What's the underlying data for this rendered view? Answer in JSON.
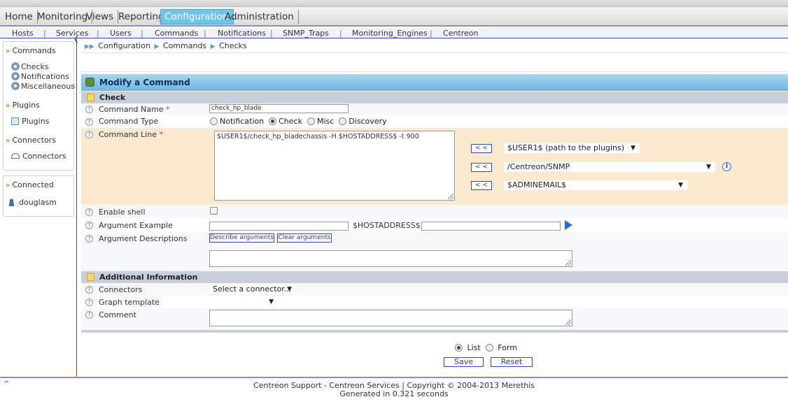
{
  "topmenu": {
    "items": [
      "Home",
      "Monitoring",
      "Views",
      "Reporting",
      "Configuration",
      "Administration"
    ],
    "active": "Configuration"
  },
  "submenu": {
    "items": [
      "Hosts",
      "Services",
      "Users",
      "Commands",
      "Notifications",
      "SNMP_Traps",
      "Monitoring_Engines",
      "Centreon"
    ]
  },
  "sidebar": {
    "commands_header": "Commands",
    "commands_items": [
      "Checks",
      "Notifications",
      "Miscellaneous"
    ],
    "plugins_header": "Plugins",
    "plugins_item": "Plugins",
    "connectors_header": "Connectors",
    "connectors_item": "Connectors",
    "connected_header": "Connected",
    "user": "douglasm"
  },
  "breadcrumb": [
    "Configuration",
    "Commands",
    "Checks"
  ],
  "form": {
    "title": "Modify a Command",
    "section_check": "Check",
    "command_name_label": "Command Name",
    "command_name_value": "check_hp_blade",
    "command_type_label": "Command Type",
    "command_type_options": [
      "Notification",
      "Check",
      "Misc",
      "Discovery"
    ],
    "command_type_selected": "Check",
    "command_line_label": "Command Line",
    "command_line_value": "$USER1$/check_hp_bladechassis -H $HOSTADDRESS$ -t 900",
    "macro_button": "< <",
    "macro_selects": [
      "$USER1$ (path to the plugins)",
      "/Centreon/SNMP",
      "$ADMINEMAIL$"
    ],
    "enable_shell_label": "Enable shell",
    "argument_example_label": "Argument Example",
    "argument_example_macro": "$HOSTADDRESS$",
    "argument_descriptions_label": "Argument Descriptions",
    "describe_arguments_button": "Describe arguments",
    "clear_arguments_button": "Clear arguments",
    "section_additional": "Additional Information",
    "connectors_label": "Connectors",
    "connectors_select": "Select a connector...",
    "graph_template_label": "Graph template",
    "graph_template_select": "",
    "comment_label": "Comment",
    "required_mark": "*",
    "help_mark": "?",
    "info_mark": "i"
  },
  "bottom": {
    "view_options": [
      "List",
      "Form"
    ],
    "view_selected": "List",
    "save_label": "Save",
    "reset_label": "Reset"
  },
  "footer": {
    "line1": "Centreon Support - Centreon Services | Copyright © 2004-2013 Merethis",
    "line2": "Generated in 0.321 seconds"
  },
  "icons": {
    "breadcrumb_start": "double-arrow-icon",
    "breadcrumb_sep": "triangle-right-icon",
    "help": "question-circle-icon",
    "chevron": "double-chevron-icon",
    "scroll_up": "caret-up-icon"
  },
  "colors": {
    "active_tab": "#6ec5ea",
    "panel_header": "#6eb7e2",
    "orange_row": "#fbe9d0",
    "link_blue": "#2a3a94",
    "chevron": "#e07b1a"
  }
}
